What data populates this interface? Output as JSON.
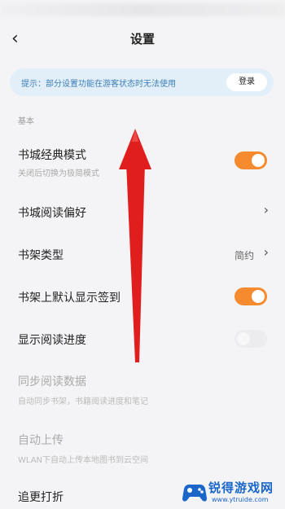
{
  "header": {
    "title": "设置",
    "back_icon": "chevron-left-icon"
  },
  "tip": {
    "text": "提示：部分设置功能在游客状态时无法使用",
    "login_label": "登录"
  },
  "section_basic": "基本",
  "rows": {
    "classic": {
      "label": "书城经典模式",
      "sub": "关闭后切换为极简模式",
      "toggle": "on"
    },
    "preference": {
      "label": "书城阅读偏好"
    },
    "shelf_type": {
      "label": "书架类型",
      "value": "简约"
    },
    "checkin": {
      "label": "书架上默认显示签到",
      "toggle": "on"
    },
    "progress": {
      "label": "显示阅读进度",
      "toggle": "off"
    },
    "sync": {
      "label": "同步阅读数据",
      "sub": "自动同步书架，书籍阅读进度和笔记"
    },
    "upload": {
      "label": "自动上传",
      "sub": "WLAN下自动上传本地图书到云空间"
    },
    "more": {
      "label": "追更打折"
    }
  },
  "watermark": {
    "brand": "锐得游戏网",
    "url": "www.ytruide.com"
  },
  "colors": {
    "accent": "#f58a2e",
    "tip_bg": "#e2eff9",
    "arrow": "#e01e1e"
  }
}
